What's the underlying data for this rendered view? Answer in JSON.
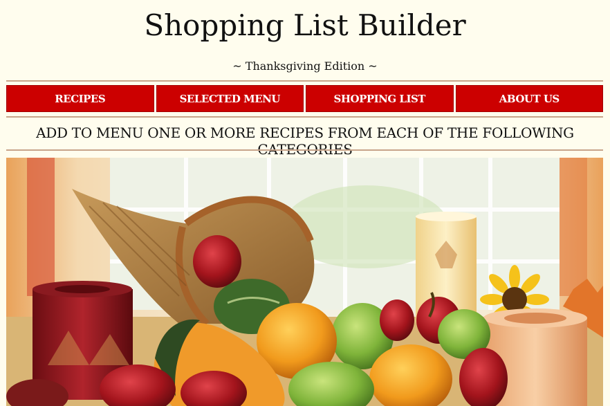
{
  "header": {
    "title": "Shopping List Builder",
    "subtitle": "~ Thanksgiving Edition ~"
  },
  "nav": {
    "items": [
      {
        "label": "RECIPES"
      },
      {
        "label": "SELECTED MENU"
      },
      {
        "label": "SHOPPING LIST"
      },
      {
        "label": "ABOUT US"
      }
    ]
  },
  "main": {
    "instructions": "ADD TO MENU ONE OR MORE RECIPES FROM EACH OF THE FOLLOWING CATEGORIES"
  },
  "colors": {
    "background": "#fffdee",
    "nav_button": "#cc0000",
    "rule": "#c8a48a"
  }
}
